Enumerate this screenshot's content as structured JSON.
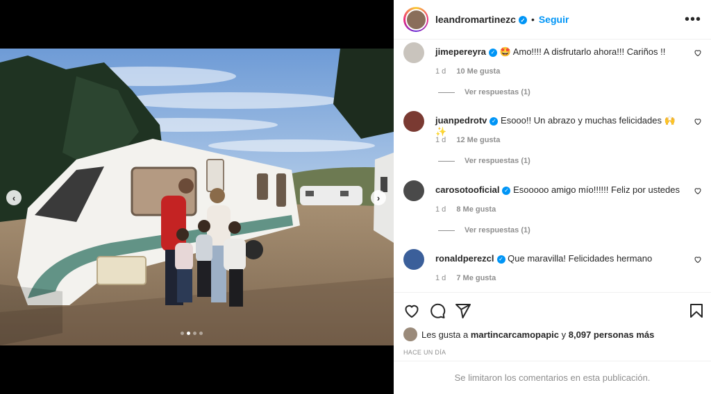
{
  "post": {
    "author": "leandromartinezc",
    "follow_label": "Seguir",
    "separator": "•",
    "more_label": "•••"
  },
  "media": {
    "prev_label": "‹",
    "next_label": "›",
    "slide_count": 4,
    "active_slide": 2
  },
  "comments": [
    {
      "user": "jimepereyra",
      "text": "🤩 Amo!!!! A disfrutarlo ahora!!! Cariños !!",
      "time": "1 d",
      "likes": "10 Me gusta",
      "replies": "Ver respuestas (1)",
      "avatar_color": "#c9c4bd"
    },
    {
      "user": "juanpedrotv",
      "text": "Esooo!! Un abrazo y muchas felicidades 🙌✨",
      "time": "1 d",
      "likes": "12 Me gusta",
      "replies": "Ver respuestas (1)",
      "avatar_color": "#7a3a32"
    },
    {
      "user": "carosotooficial",
      "text": "Esooooo amigo mío!!!!!! Feliz por ustedes",
      "time": "1 d",
      "likes": "8 Me gusta",
      "replies": "Ver respuestas (1)",
      "avatar_color": "#4a4a4a"
    },
    {
      "user": "ronaldperezcl",
      "text": "Que maravilla! Felicidades hermano",
      "time": "1 d",
      "likes": "7 Me gusta",
      "replies": "",
      "avatar_color": "#3b5f9a"
    }
  ],
  "likes_summary": {
    "prefix": "Les gusta a",
    "user": "martincarcamopapic",
    "middle": "y",
    "count": "8,097 personas más"
  },
  "time_ago": "HACE UN DÍA",
  "comments_limited": "Se limitaron los comentarios en esta publicación.",
  "colors": {
    "accent": "#0095f6",
    "muted": "#8e8e8e",
    "text": "#262626"
  }
}
